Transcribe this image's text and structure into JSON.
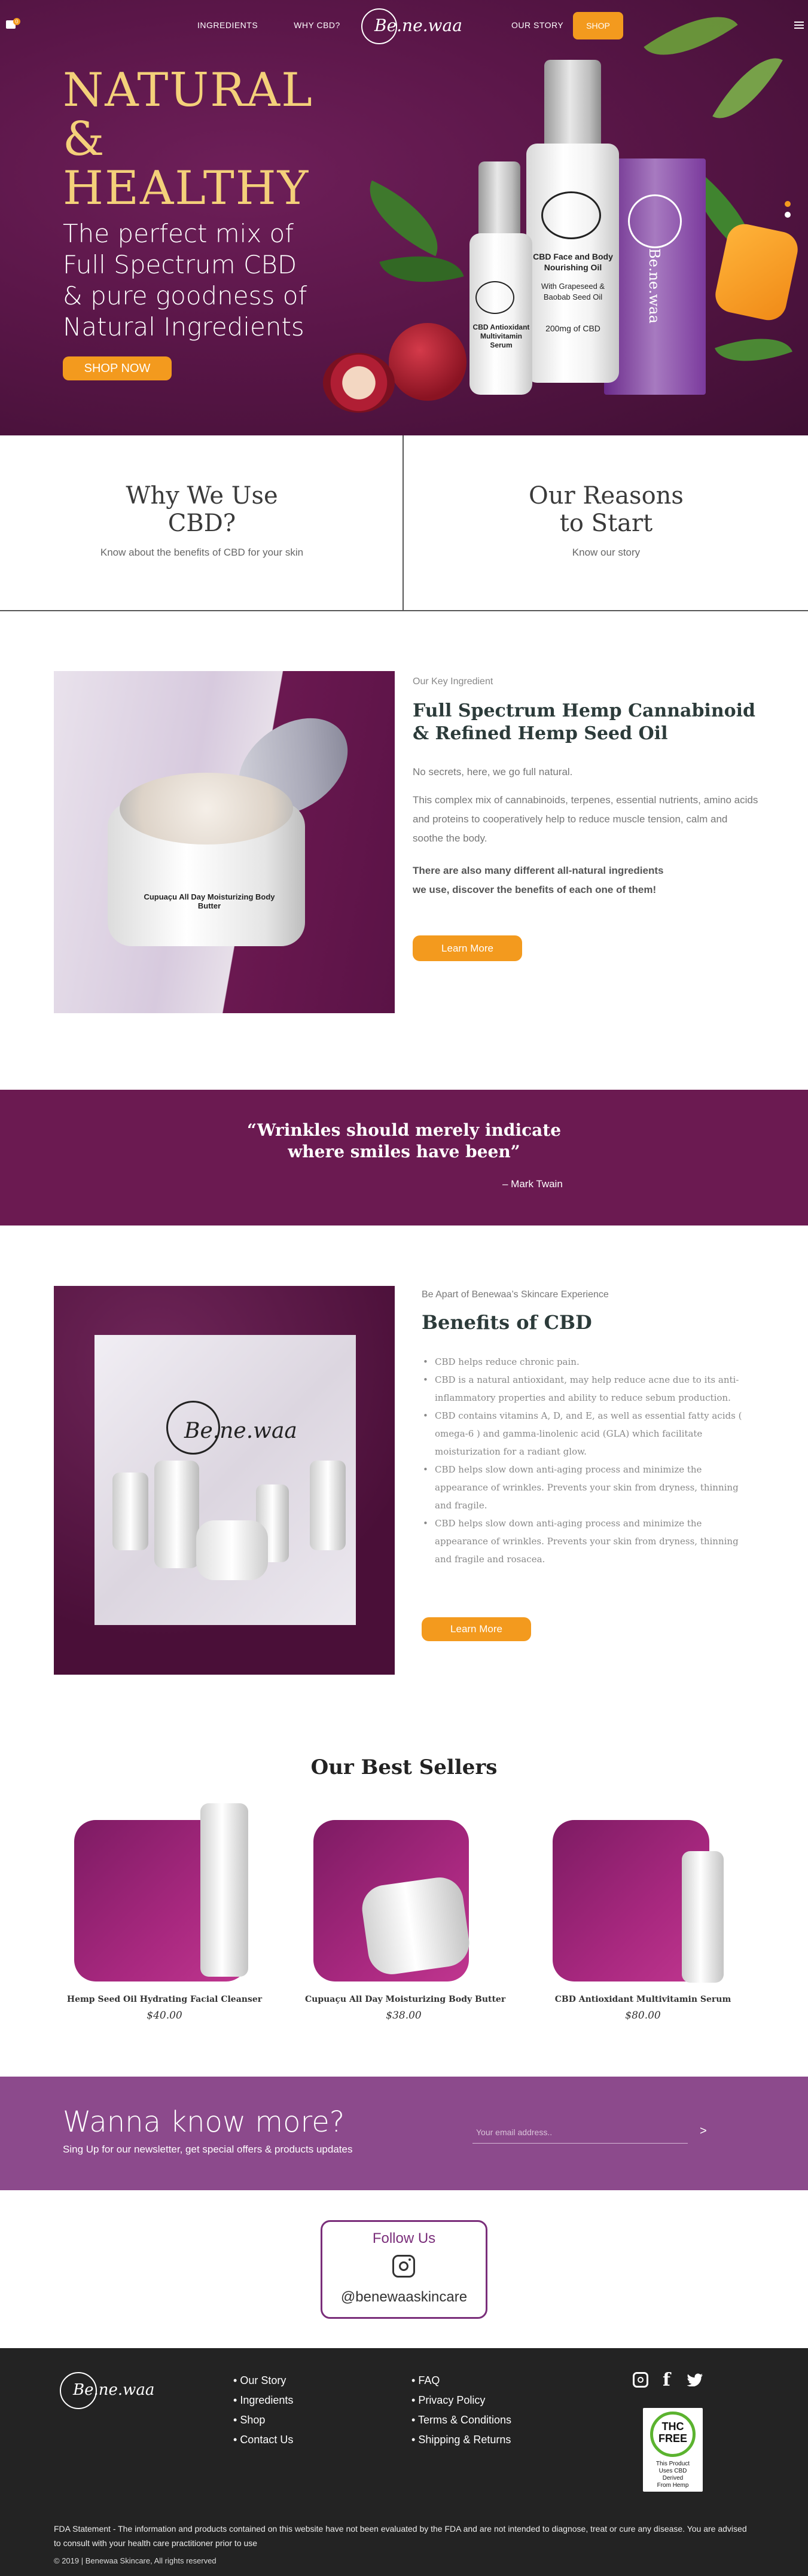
{
  "header": {
    "nav_left": [
      "INGREDIENTS",
      "WHY CBD?"
    ],
    "logo": "Be.ne.waa",
    "nav_right": [
      "OUR STORY"
    ],
    "shop_label": "SHOP",
    "cart_count": "0"
  },
  "hero": {
    "title_line1": "NATURAL",
    "title_line2": "&",
    "title_line3": "HEALTHY",
    "subtitle_line1": "The perfect mix of",
    "subtitle_line2": "Full Spectrum CBD",
    "subtitle_line3": "& pure goodness of",
    "subtitle_line4": "Natural Ingredients",
    "cta_label": "SHOP NOW",
    "bottle1_label": "CBD Antioxidant Multivitamin Serum",
    "bottle2_label_a": "CBD Face and Body",
    "bottle2_label_b": "Nourishing Oil",
    "bottle2_label_c": "With Grapeseed &",
    "bottle2_label_d": "Baobab Seed Oil",
    "bottle2_label_e": "200mg of CBD",
    "box_label": "Be.ne.waa",
    "accent": "#f39a1e",
    "title_color": "#f4d07a"
  },
  "reasons": [
    {
      "title_line1": "Why We Use",
      "title_line2": "CBD?",
      "subtitle": "Know about the benefits of CBD for your skin"
    },
    {
      "title_line1": "Our Reasons",
      "title_line2": "to Start",
      "subtitle": "Know our story"
    }
  ],
  "key_ingredient": {
    "eyebrow": "Our Key Ingredient",
    "title_line1": "Full Spectrum Hemp Cannabinoid",
    "title_line2": "& Refined Hemp Seed Oil",
    "p1": "No secrets, here, we go full natural.",
    "p2": "This complex mix of cannabinoids, terpenes, essential nutrients, amino acids and proteins to cooperatively help to reduce muscle tension, calm and soothe the body.",
    "p3_line1": "There are also many different all-natural ingredients",
    "p3_line2": "we use, discover the benefits of each one of them!",
    "button": "Learn More",
    "jar_label": "Cupuaçu All Day Moisturizing Body Butter"
  },
  "quote": {
    "line1": "“Wrinkles should merely indicate",
    "line2": "where smiles have been”",
    "author": "– Mark Twain"
  },
  "benefits": {
    "eyebrow": "Be Apart of Benewaa’s Skincare Experience",
    "title": "Benefits of CBD",
    "items": [
      "CBD helps reduce chronic pain.",
      "CBD is a natural antioxidant, may help reduce acne due to its anti-inflammatory properties and ability to reduce sebum production.",
      "CBD contains vitamins A, D, and E, as well as essential fatty acids ( omega-6 ) and gamma-linolenic acid (GLA) which facilitate moisturization for a radiant glow.",
      "CBD helps slow down anti-aging process and minimize the appearance of wrinkles. Prevents your skin from dryness, thinning and fragile.",
      "CBD helps slow down anti-aging process and minimize the appearance of wrinkles. Prevents your skin from dryness, thinning and fragile and rosacea."
    ],
    "button": "Learn More",
    "photo_logo": "Be.ne.waa"
  },
  "best_sellers": {
    "title": "Our Best Sellers",
    "products": [
      {
        "name": "Hemp Seed Oil Hydrating Facial Cleanser",
        "price": "$40.00"
      },
      {
        "name": "Cupuaçu All Day Moisturizing Body Butter",
        "price": "$38.00"
      },
      {
        "name": "CBD Antioxidant Multivitamin Serum",
        "price": "$80.00"
      }
    ]
  },
  "newsletter": {
    "title": "Wanna know more?",
    "subtitle": "Sing Up for our newsletter, get special offers & products updates",
    "email_placeholder": "Your email address..",
    "submit": ">"
  },
  "follow": {
    "title": "Follow Us",
    "handle": "@benewaaskincare"
  },
  "footer": {
    "logo": "Be.ne.waa",
    "col1": [
      "Our Story",
      "Ingredients",
      "Shop",
      "Contact Us"
    ],
    "col2": [
      "FAQ",
      "Privacy Policy",
      "Terms & Conditions",
      "Shipping & Returns"
    ],
    "badge": {
      "line1": "THC",
      "line2": "FREE",
      "line3": "This Product",
      "line4": "Uses CBD",
      "line5": "Derived",
      "line6": "From Hemp"
    },
    "fda": "FDA Statement - The information and products contained on this website have not been evaluated by the FDA and are not intended to diagnose, treat or cure any disease. You are advised to consult with your health care practitioner prior to use",
    "copyright": "© 2019 | Benewaa Skincare, All rights reserved"
  }
}
